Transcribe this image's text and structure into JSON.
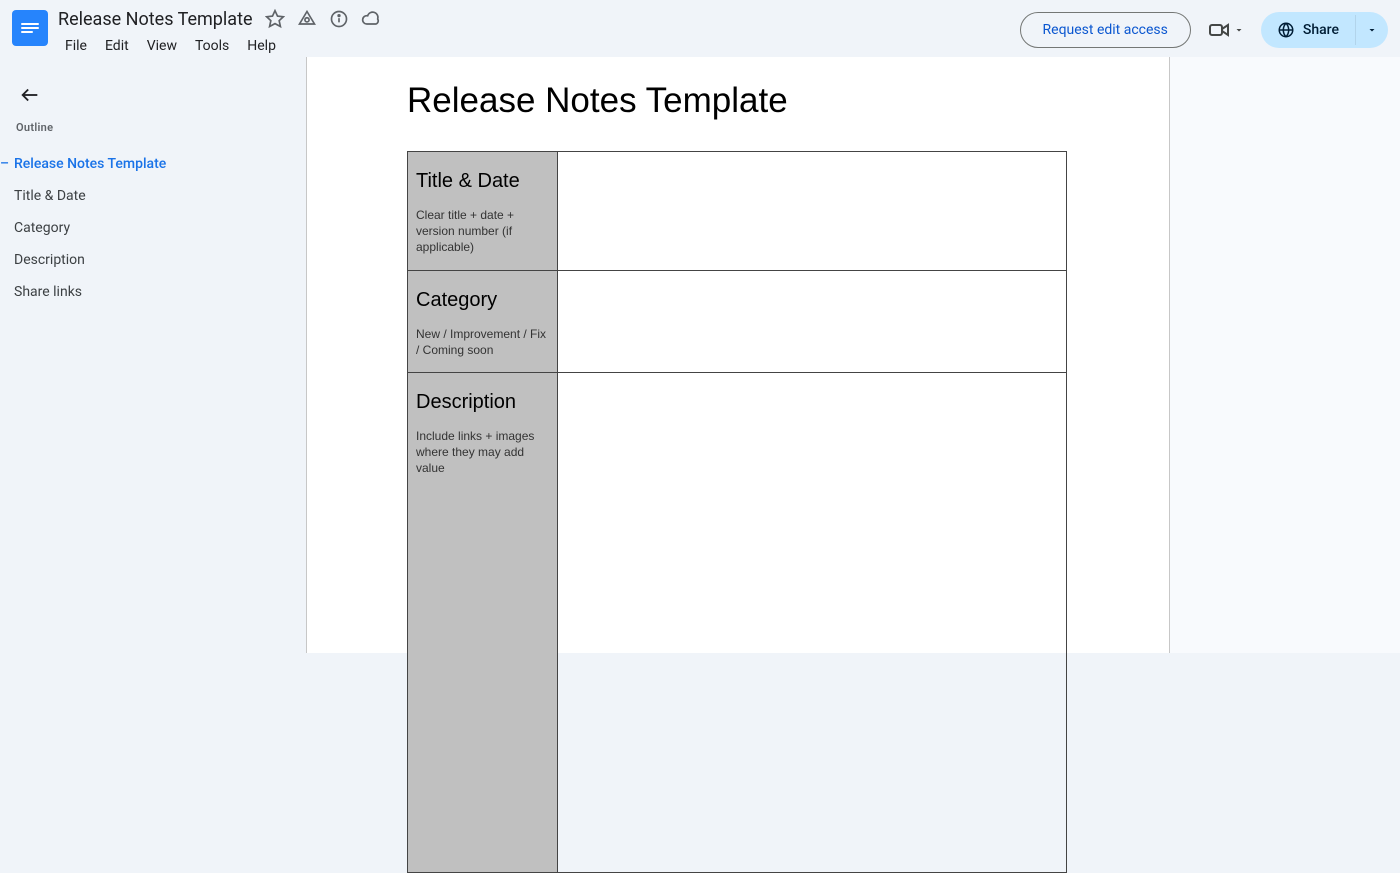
{
  "header": {
    "doc_title": "Release Notes Template",
    "menus": [
      "File",
      "Edit",
      "View",
      "Tools",
      "Help"
    ],
    "request_edit": "Request edit access",
    "share": "Share"
  },
  "outline": {
    "label": "Outline",
    "items": [
      {
        "label": "Release Notes Template",
        "active": true
      },
      {
        "label": "Title & Date",
        "active": false
      },
      {
        "label": "Category",
        "active": false
      },
      {
        "label": "Description",
        "active": false
      },
      {
        "label": "Share links",
        "active": false
      }
    ]
  },
  "document": {
    "heading": "Release Notes Template",
    "rows": [
      {
        "title": "Title & Date",
        "desc": "Clear title + date + version number (if applicable)"
      },
      {
        "title": "Category",
        "desc": "New / Improvement / Fix / Coming soon"
      },
      {
        "title": "Description",
        "desc": "Include links + images where they may add value"
      }
    ]
  }
}
